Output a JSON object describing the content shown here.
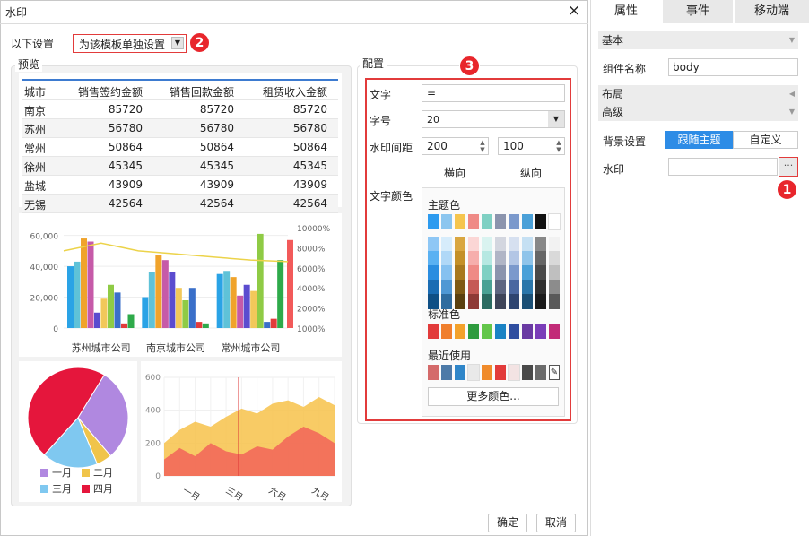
{
  "dialog": {
    "title": "水印",
    "close_icon": "×"
  },
  "settings": {
    "label": "以下设置",
    "mode_value": "为该模板单独设置",
    "dropdown_icon": "▼"
  },
  "badges": {
    "b1": "1",
    "b2": "2",
    "b3": "3"
  },
  "preview": {
    "label": "预览",
    "table": {
      "headers": [
        "城市",
        "销售签约金额",
        "销售回款金额",
        "租赁收入金额"
      ],
      "rows": [
        [
          "南京",
          "85720",
          "85720",
          "85720"
        ],
        [
          "苏州",
          "56780",
          "56780",
          "56780"
        ],
        [
          "常州",
          "50864",
          "50864",
          "50864"
        ],
        [
          "徐州",
          "45345",
          "45345",
          "45345"
        ],
        [
          "盐城",
          "43909",
          "43909",
          "43909"
        ],
        [
          "无锡",
          "42564",
          "42564",
          "42564"
        ]
      ]
    },
    "bar_chart": {
      "left_ticks": [
        "60,000",
        "40,000",
        "20,000",
        "0"
      ],
      "right_ticks": [
        "10000%",
        "8000%",
        "6000%",
        "4000%",
        "2000%",
        "1000%"
      ],
      "categories": [
        "苏州城市公司",
        "南京城市公司",
        "常州城市公司"
      ]
    },
    "pie_chart": {
      "legend": [
        "一月",
        "二月",
        "三月",
        "四月"
      ]
    },
    "area_chart": {
      "y_ticks": [
        "600",
        "400",
        "200",
        "0"
      ],
      "x_labels": [
        "一月",
        "三月",
        "六月",
        "九月"
      ]
    }
  },
  "chart_data": [
    {
      "type": "bar",
      "categories": [
        "苏州城市公司",
        "南京城市公司",
        "常州城市公司"
      ],
      "ylim": [
        0,
        65000
      ],
      "series": [
        {
          "values": [
            40000,
            20000,
            35000
          ]
        },
        {
          "values": [
            43000,
            36000,
            37000
          ]
        },
        {
          "values": [
            58000,
            47000,
            33000
          ]
        },
        {
          "values": [
            56000,
            44000,
            21000
          ]
        },
        {
          "values": [
            10000,
            36000,
            28000
          ]
        },
        {
          "values": [
            19000,
            26000,
            24000
          ]
        },
        {
          "values": [
            28000,
            18000,
            61000
          ]
        },
        {
          "values": [
            23000,
            26000,
            4000
          ]
        },
        {
          "values": [
            3000,
            4000,
            6000
          ]
        },
        {
          "values": [
            9000,
            3000,
            44000
          ]
        }
      ],
      "line": [
        50000,
        55000,
        50000,
        48000,
        46000,
        44000,
        43000
      ],
      "right_ylim": [
        0,
        10000
      ]
    },
    {
      "type": "pie",
      "labels": [
        "一月",
        "二月",
        "三月",
        "四月"
      ],
      "values": [
        30,
        5,
        18,
        47
      ]
    },
    {
      "type": "area",
      "x_labels": [
        "一月",
        "三月",
        "六月",
        "九月"
      ],
      "ylim": [
        0,
        600
      ],
      "series": [
        {
          "values": [
            200,
            280,
            330,
            300,
            360,
            410,
            380,
            440,
            460,
            420,
            480,
            430
          ]
        },
        {
          "values": [
            100,
            170,
            120,
            200,
            150,
            130,
            180,
            160,
            240,
            300,
            260,
            200
          ]
        }
      ]
    }
  ],
  "config": {
    "label": "配置",
    "text_label": "文字",
    "text_value": "=",
    "size_label": "字号",
    "size_value": "20",
    "size_dropdown_icon": "▼",
    "spacing_label": "水印间距",
    "h_value": "200",
    "v_value": "100",
    "h_label": "横向",
    "v_label": "纵向",
    "color_label": "文字颜色",
    "theme_label": "主题色",
    "standard_label": "标准色",
    "recent_label": "最近使用",
    "more_label": "更多颜色...",
    "theme_top": [
      "#2d9bef",
      "#8cc6ef",
      "#f5c54e",
      "#ef8a86",
      "#7fd0c3",
      "#8b94ad",
      "#7b99cc",
      "#4aa0d8",
      "#111111",
      "#ffffff"
    ],
    "theme_cols": [
      [
        "#8ec7f5",
        "#5ab1f2",
        "#2a8de0",
        "#1a6cb3",
        "#0f4f85"
      ],
      [
        "#d6ecfb",
        "#b0d8f7",
        "#86c1f0",
        "#4f98d4",
        "#2f6c9f"
      ],
      [
        "#d9a640",
        "#c49028",
        "#a8781d",
        "#7e5a15",
        "#5a400f"
      ],
      [
        "#fbd6d5",
        "#f6aeac",
        "#ef8a86",
        "#c55a56",
        "#8e3936"
      ],
      [
        "#d9f3f0",
        "#b6e8e2",
        "#7fd0c3",
        "#4aa194",
        "#2b6b61"
      ],
      [
        "#d3d6df",
        "#b0b5c6",
        "#8b94ad",
        "#5d6580",
        "#3e4459"
      ],
      [
        "#d6e0f0",
        "#b3c6e5",
        "#7b99cc",
        "#4a67a0",
        "#2e4470"
      ],
      [
        "#c5e0f3",
        "#8fc4ea",
        "#4aa0d8",
        "#2b76aa",
        "#1b4f75"
      ],
      [
        "#888888",
        "#666666",
        "#4a4a4a",
        "#2e2e2e",
        "#1a1a1a"
      ],
      [
        "#f2f2f2",
        "#d9d9d9",
        "#bfbfbf",
        "#8c8c8c",
        "#595959"
      ]
    ],
    "standard": [
      "#e23b3b",
      "#f07f2e",
      "#f3a12b",
      "#2e9b3e",
      "#63c64a",
      "#1a82c4",
      "#2f4ea0",
      "#6a3aa3",
      "#7a3db8",
      "#c22b78"
    ],
    "recent": [
      "#d46a6a",
      "#4d7aa8",
      "#2f86c9",
      "#e9e9e9",
      "#f08b2b",
      "#e23b3b",
      "#f3e3e3",
      "#4a4a4a",
      "#6b6b6b"
    ]
  },
  "footer": {
    "ok": "确定",
    "cancel": "取消"
  },
  "panel": {
    "tabs": [
      "属性",
      "事件",
      "移动端"
    ],
    "basic": "基本",
    "name_label": "组件名称",
    "name_value": "body",
    "layout": "布局",
    "advanced": "高级",
    "bg_label": "背景设置",
    "bg_theme": "跟随主题",
    "bg_custom": "自定义",
    "watermark_label": "水印",
    "more_icon": "···",
    "arrow_down": "▼",
    "arrow_left": "◀"
  },
  "colors": {
    "accent": "#2d8ce6",
    "highlight": "#e23b3b"
  }
}
